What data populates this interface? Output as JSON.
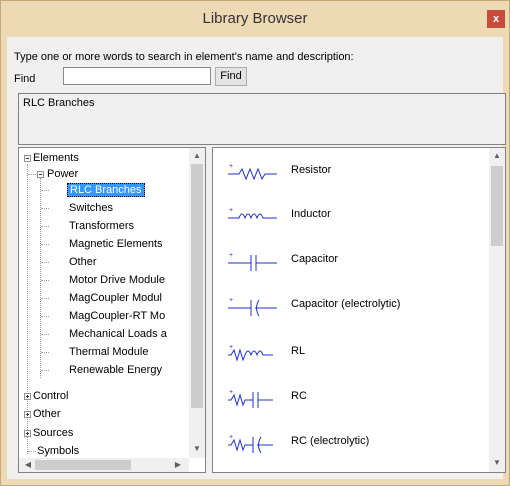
{
  "window": {
    "title": "Library Browser",
    "close_label": "x"
  },
  "search": {
    "instruction": "Type one or more words to search in element's name and  description:",
    "find_label": "Find",
    "input_value": "",
    "find_button": "Find"
  },
  "description": {
    "text": "RLC Branches"
  },
  "tree": {
    "elements": "Elements",
    "power": "Power",
    "power_children": [
      "RLC Branches",
      "Switches",
      "Transformers",
      "Magnetic Elements",
      "Other",
      "Motor Drive Module",
      "MagCoupler Modul",
      "MagCoupler-RT Mo",
      "Mechanical Loads a",
      "Thermal Module",
      "Renewable Energy"
    ],
    "control": "Control",
    "other": "Other",
    "sources": "Sources",
    "symbols": "Symbols"
  },
  "elements_list": [
    {
      "label": "Resistor",
      "icon": "resistor-icon"
    },
    {
      "label": "Inductor",
      "icon": "inductor-icon"
    },
    {
      "label": "Capacitor",
      "icon": "capacitor-icon"
    },
    {
      "label": "Capacitor (electrolytic)",
      "icon": "electrolytic-capacitor-icon"
    },
    {
      "label": "RL",
      "icon": "rl-icon"
    },
    {
      "label": "RC",
      "icon": "rc-icon"
    },
    {
      "label": "RC (electrolytic)",
      "icon": "rc-electrolytic-icon"
    }
  ],
  "colors": {
    "selection": "#3399ff",
    "symbol": "#1f2fd1",
    "title_bar": "#edd9b4",
    "close": "#c94b3c"
  }
}
